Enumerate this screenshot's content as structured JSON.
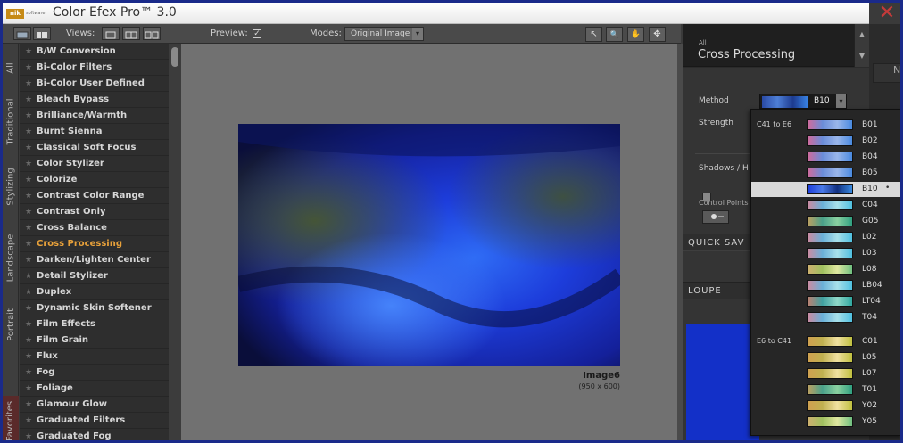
{
  "window": {
    "logo_text": "nik",
    "logo_sub": "software",
    "title": "Color Efex Pro™ 3.0",
    "close_glyph": "✕"
  },
  "toolbar": {
    "views_label": "Views:",
    "preview_label": "Preview:",
    "preview_checked": "✓",
    "modes_label": "Modes:",
    "mode_value": "Original Image",
    "dropdown_glyph": "▾"
  },
  "vertical_tabs": [
    "All",
    "Traditional",
    "Stylizing",
    "Landscape",
    "Portrait",
    "Favorites"
  ],
  "filters": [
    {
      "label": "B/W Conversion"
    },
    {
      "label": "Bi-Color Filters"
    },
    {
      "label": "Bi-Color User Defined"
    },
    {
      "label": "Bleach Bypass"
    },
    {
      "label": "Brilliance/Warmth"
    },
    {
      "label": "Burnt Sienna"
    },
    {
      "label": "Classical Soft Focus"
    },
    {
      "label": "Color Stylizer"
    },
    {
      "label": "Colorize"
    },
    {
      "label": "Contrast Color Range"
    },
    {
      "label": "Contrast Only"
    },
    {
      "label": "Cross Balance"
    },
    {
      "label": "Cross Processing",
      "active": true
    },
    {
      "label": "Darken/Lighten Center"
    },
    {
      "label": "Detail Stylizer"
    },
    {
      "label": "Duplex"
    },
    {
      "label": "Dynamic Skin Softener"
    },
    {
      "label": "Film Effects"
    },
    {
      "label": "Film Grain"
    },
    {
      "label": "Flux"
    },
    {
      "label": "Fog"
    },
    {
      "label": "Foliage"
    },
    {
      "label": "Glamour Glow"
    },
    {
      "label": "Graduated Filters"
    },
    {
      "label": "Graduated Fog"
    }
  ],
  "canvas": {
    "image_name": "Image6",
    "image_size": "(950 x 600)",
    "tools": [
      "↖",
      "🔍",
      "✋",
      "✥"
    ]
  },
  "panel": {
    "category": "All",
    "title": "Cross Processing",
    "up": "▲",
    "down": "▼",
    "method_label": "Method",
    "method_value": "B10",
    "strength_label": "Strength",
    "shadows_label": "Shadows / H",
    "control_points_label": "Control Points",
    "quick_save": "QUICK SAV",
    "loupe": "LOUPE",
    "right_tab": "N"
  },
  "method_dropdown": {
    "groups": [
      {
        "label": "C41 to E6",
        "start_index": 0
      },
      {
        "label": "E6 to C41",
        "start_index": 14
      }
    ],
    "options": [
      {
        "code": "B01",
        "tint": "blue"
      },
      {
        "code": "B02",
        "tint": "blue"
      },
      {
        "code": "B04",
        "tint": "blue"
      },
      {
        "code": "B05",
        "tint": "blue"
      },
      {
        "code": "B10",
        "tint": "deepblue",
        "selected": true,
        "marker": "•"
      },
      {
        "code": "C04",
        "tint": "cyan"
      },
      {
        "code": "G05",
        "tint": "green"
      },
      {
        "code": "L02",
        "tint": "cyan"
      },
      {
        "code": "L03",
        "tint": "cyan"
      },
      {
        "code": "L08",
        "tint": "yellowgreen"
      },
      {
        "code": "LB04",
        "tint": "cyan"
      },
      {
        "code": "LT04",
        "tint": "teal"
      },
      {
        "code": "T04",
        "tint": "cyan"
      },
      {
        "code": "C01",
        "tint": "yellow"
      },
      {
        "code": "L05",
        "tint": "yellow"
      },
      {
        "code": "L07",
        "tint": "yellow"
      },
      {
        "code": "T01",
        "tint": "green"
      },
      {
        "code": "Y02",
        "tint": "yellow"
      },
      {
        "code": "Y05",
        "tint": "yellowgreen"
      }
    ]
  },
  "colors": {
    "active_filter": "#e8a13a",
    "frame": "#1a2a8a",
    "close": "#c43a3a"
  }
}
